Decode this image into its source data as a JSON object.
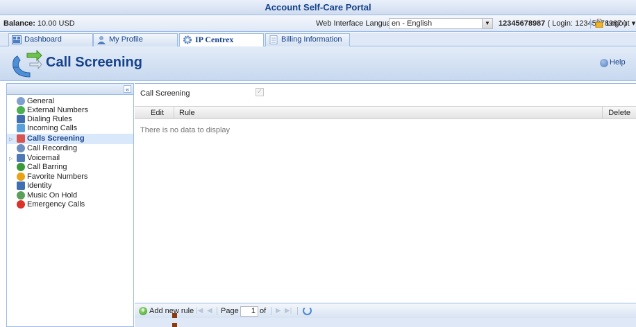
{
  "app": {
    "title": "Account Self-Care Portal"
  },
  "infobar": {
    "balance_label": "Balance:",
    "balance_value": "10.00 USD",
    "language_label": "Web Interface Language:",
    "language_value": "en - English",
    "account_number": "12345678987",
    "login_text": "( Login: 12345678987 )",
    "logout_label": "Logout"
  },
  "tabs": [
    {
      "label": "Dashboard",
      "icon": "dashboard-icon"
    },
    {
      "label": "My Profile",
      "icon": "profile-icon"
    },
    {
      "label": "IP Centrex",
      "icon": "gear-icon"
    },
    {
      "label": "Billing Information",
      "icon": "document-icon"
    }
  ],
  "header": {
    "title": "Call Screening",
    "help_label": "Help"
  },
  "sidebar": {
    "collapse_symbol": "«",
    "items": [
      {
        "label": "General",
        "icon": "gear-icon",
        "color": "#7f9fcf"
      },
      {
        "label": "External Numbers",
        "icon": "external-numbers-icon",
        "color": "#4caf50"
      },
      {
        "label": "Dialing Rules",
        "icon": "dialing-rules-icon",
        "color": "#3f6fb0"
      },
      {
        "label": "Incoming Calls",
        "icon": "incoming-calls-icon",
        "color": "#5aa0d8"
      },
      {
        "label": "Calls Screening",
        "icon": "calls-screening-icon",
        "color": "#d9534f"
      },
      {
        "label": "Call Recording",
        "icon": "call-recording-icon",
        "color": "#6c8ebf"
      },
      {
        "label": "Voicemail",
        "icon": "voicemail-icon",
        "color": "#4f79b5"
      },
      {
        "label": "Call Barring",
        "icon": "call-barring-icon",
        "color": "#3a9a3a"
      },
      {
        "label": "Favorite Numbers",
        "icon": "favorite-numbers-icon",
        "color": "#e8a317"
      },
      {
        "label": "Identity",
        "icon": "identity-icon",
        "color": "#3f6fb0"
      },
      {
        "label": "Music On Hold",
        "icon": "music-on-hold-icon",
        "color": "#5aa05a"
      },
      {
        "label": "Emergency Calls",
        "icon": "emergency-calls-icon",
        "color": "#d9332a"
      }
    ]
  },
  "main": {
    "call_screening_label": "Call Screening",
    "call_screening_checked": true,
    "columns": {
      "edit": "Edit",
      "rule": "Rule",
      "delete": "Delete"
    },
    "empty_text": "There is no data to display"
  },
  "pager": {
    "add_label": "Add new rule",
    "page_label": "Page",
    "page_value": "1",
    "of_label": "of"
  }
}
